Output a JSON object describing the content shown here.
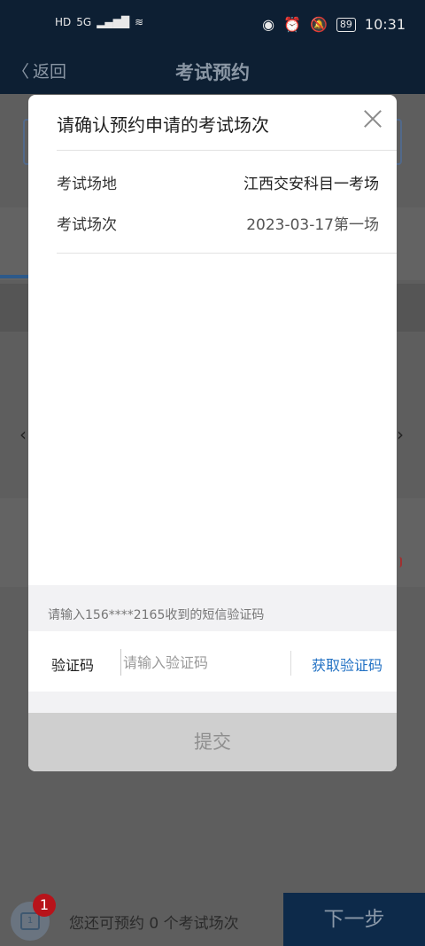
{
  "status_bar": {
    "hd": "HD",
    "network": "5G",
    "battery": "89",
    "time": "10:31"
  },
  "header": {
    "back_label": "返回",
    "title": "考试预约"
  },
  "bottom_bar": {
    "badge_count": "1",
    "calendar_day": "1",
    "remaining_text": "您还可预约 0 个考试场次",
    "next_label": "下一步"
  },
  "modal": {
    "title": "请确认预约申请的考试场次",
    "rows": [
      {
        "label": "考试场地",
        "value": "江西交安科目一考场"
      },
      {
        "label": "考试场次",
        "value": "2023-03-17第一场"
      }
    ],
    "sms_hint": "请输入156****2165收到的短信验证码",
    "code_label": "验证码",
    "code_placeholder": "请输入验证码",
    "get_code_label": "获取验证码",
    "submit_label": "提交"
  },
  "colors": {
    "header_bg": "#0d1f33",
    "link_blue": "#2372c4",
    "badge_red": "#b8131a",
    "submit_disabled": "#cfcfcf"
  }
}
